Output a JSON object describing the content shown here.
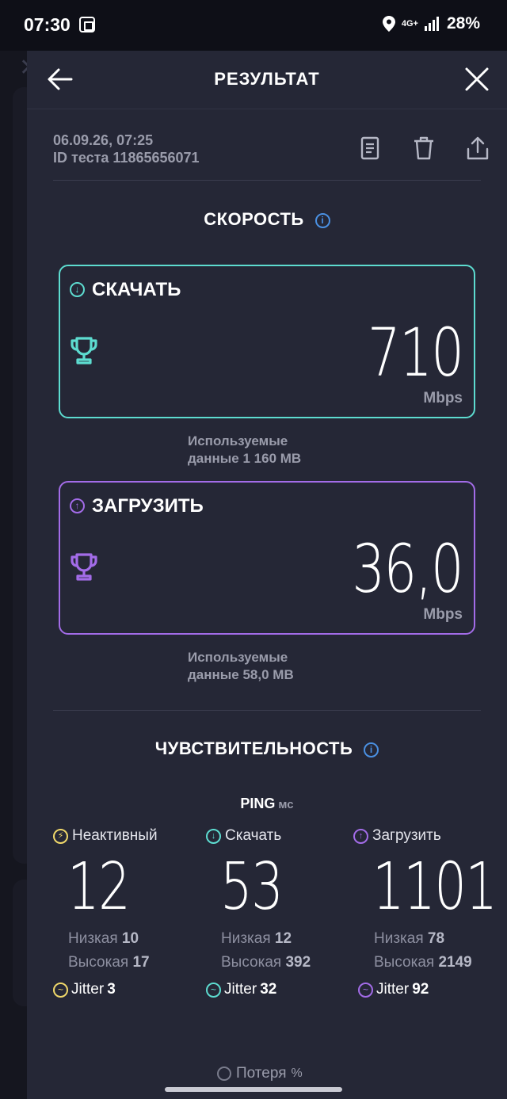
{
  "status_bar": {
    "time": "07:30",
    "network": "4G+",
    "battery": "28%"
  },
  "header": {
    "title": "РЕЗУЛЬТАТ"
  },
  "meta": {
    "date": "06.09.26, 07:25",
    "test_id": "ID теста 11865656071"
  },
  "speed": {
    "title": "СКОРОСТЬ",
    "download": {
      "label": "СКАЧАТЬ",
      "value": "710",
      "unit": "Mbps",
      "used_line1": "Используемые",
      "used_line2": "данные 1 160 MB"
    },
    "upload": {
      "label": "ЗАГРУЗИТЬ",
      "value": "36,0",
      "unit": "Mbps",
      "used_line1": "Используемые",
      "used_line2": "данные 58,0 MB"
    }
  },
  "sensitivity": {
    "title": "ЧУВСТВИТЕЛЬНОСТЬ",
    "ping_label": "PING",
    "ping_unit": "мс",
    "columns": [
      {
        "label": "Неактивный",
        "value": "12",
        "low_label": "Низкая",
        "low": "10",
        "high_label": "Высокая",
        "high": "17",
        "jitter_label": "Jitter",
        "jitter": "3"
      },
      {
        "label": "Скачать",
        "value": "53",
        "low_label": "Низкая",
        "low": "12",
        "high_label": "Высокая",
        "high": "392",
        "jitter_label": "Jitter",
        "jitter": "32"
      },
      {
        "label": "Загрузить",
        "value": "1101",
        "low_label": "Низкая",
        "low": "78",
        "high_label": "Высокая",
        "high": "2149",
        "jitter_label": "Jitter",
        "jitter": "92"
      }
    ],
    "loss_label": "Потеря",
    "loss_unit": "%"
  },
  "colors": {
    "download": "#5ddcd0",
    "upload": "#a36ce8",
    "idle": "#f0d86a",
    "info": "#4a90e2",
    "background": "#252736"
  }
}
